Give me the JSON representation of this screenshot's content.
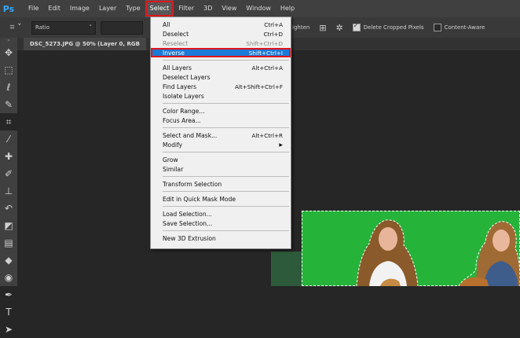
{
  "app": {
    "logo": "Ps"
  },
  "menubar": {
    "items": [
      "File",
      "Edit",
      "Image",
      "Layer",
      "Type",
      "Select",
      "Filter",
      "3D",
      "View",
      "Window",
      "Help"
    ],
    "active": "Select"
  },
  "options": {
    "ratio_label": "Ratio",
    "straighten_label": "ighten",
    "delete_cropped_label": "Delete Cropped Pixels",
    "delete_cropped_checked": true,
    "content_aware_label": "Content-Aware",
    "content_aware_checked": false
  },
  "document": {
    "tab_title": "DSC_5273.JPG @ 50% (Layer 0, RGB"
  },
  "select_menu": {
    "groups": [
      [
        {
          "label": "All",
          "shortcut": "Ctrl+A"
        },
        {
          "label": "Deselect",
          "shortcut": "Ctrl+D"
        },
        {
          "label": "Reselect",
          "shortcut": "Shift+Ctrl+D",
          "disabled": true
        },
        {
          "label": "Inverse",
          "shortcut": "Shift+Ctrl+I",
          "highlighted": true
        }
      ],
      [
        {
          "label": "All Layers",
          "shortcut": "Alt+Ctrl+A"
        },
        {
          "label": "Deselect Layers",
          "shortcut": ""
        },
        {
          "label": "Find Layers",
          "shortcut": "Alt+Shift+Ctrl+F"
        },
        {
          "label": "Isolate Layers",
          "shortcut": ""
        }
      ],
      [
        {
          "label": "Color Range...",
          "shortcut": ""
        },
        {
          "label": "Focus Area...",
          "shortcut": ""
        }
      ],
      [
        {
          "label": "Select and Mask...",
          "shortcut": "Alt+Ctrl+R"
        },
        {
          "label": "Modify",
          "shortcut": "",
          "submenu": true
        }
      ],
      [
        {
          "label": "Grow",
          "shortcut": ""
        },
        {
          "label": "Similar",
          "shortcut": ""
        }
      ],
      [
        {
          "label": "Transform Selection",
          "shortcut": ""
        }
      ],
      [
        {
          "label": "Edit in Quick Mask Mode",
          "shortcut": ""
        }
      ],
      [
        {
          "label": "Load Selection...",
          "shortcut": ""
        },
        {
          "label": "Save Selection...",
          "shortcut": ""
        }
      ],
      [
        {
          "label": "New 3D Extrusion",
          "shortcut": ""
        }
      ]
    ]
  },
  "tools": [
    {
      "name": "move-tool-icon",
      "glyph": "✥"
    },
    {
      "name": "marquee-tool-icon",
      "glyph": "⬚"
    },
    {
      "name": "lasso-tool-icon",
      "glyph": "ℓ"
    },
    {
      "name": "quick-select-tool-icon",
      "glyph": "✎"
    },
    {
      "name": "crop-tool-icon",
      "glyph": "⌗",
      "selected": true
    },
    {
      "name": "eyedropper-tool-icon",
      "glyph": "⁄"
    },
    {
      "name": "healing-brush-tool-icon",
      "glyph": "✚"
    },
    {
      "name": "brush-tool-icon",
      "glyph": "✐"
    },
    {
      "name": "clone-stamp-tool-icon",
      "glyph": "⊥"
    },
    {
      "name": "history-brush-tool-icon",
      "glyph": "↶"
    },
    {
      "name": "eraser-tool-icon",
      "glyph": "◩"
    },
    {
      "name": "gradient-tool-icon",
      "glyph": "▤"
    },
    {
      "name": "blur-tool-icon",
      "glyph": "◆"
    },
    {
      "name": "dodge-tool-icon",
      "glyph": "◉"
    },
    {
      "name": "pen-tool-icon",
      "glyph": "✒"
    },
    {
      "name": "type-tool-icon",
      "glyph": "T"
    },
    {
      "name": "path-select-tool-icon",
      "glyph": "➤"
    }
  ]
}
